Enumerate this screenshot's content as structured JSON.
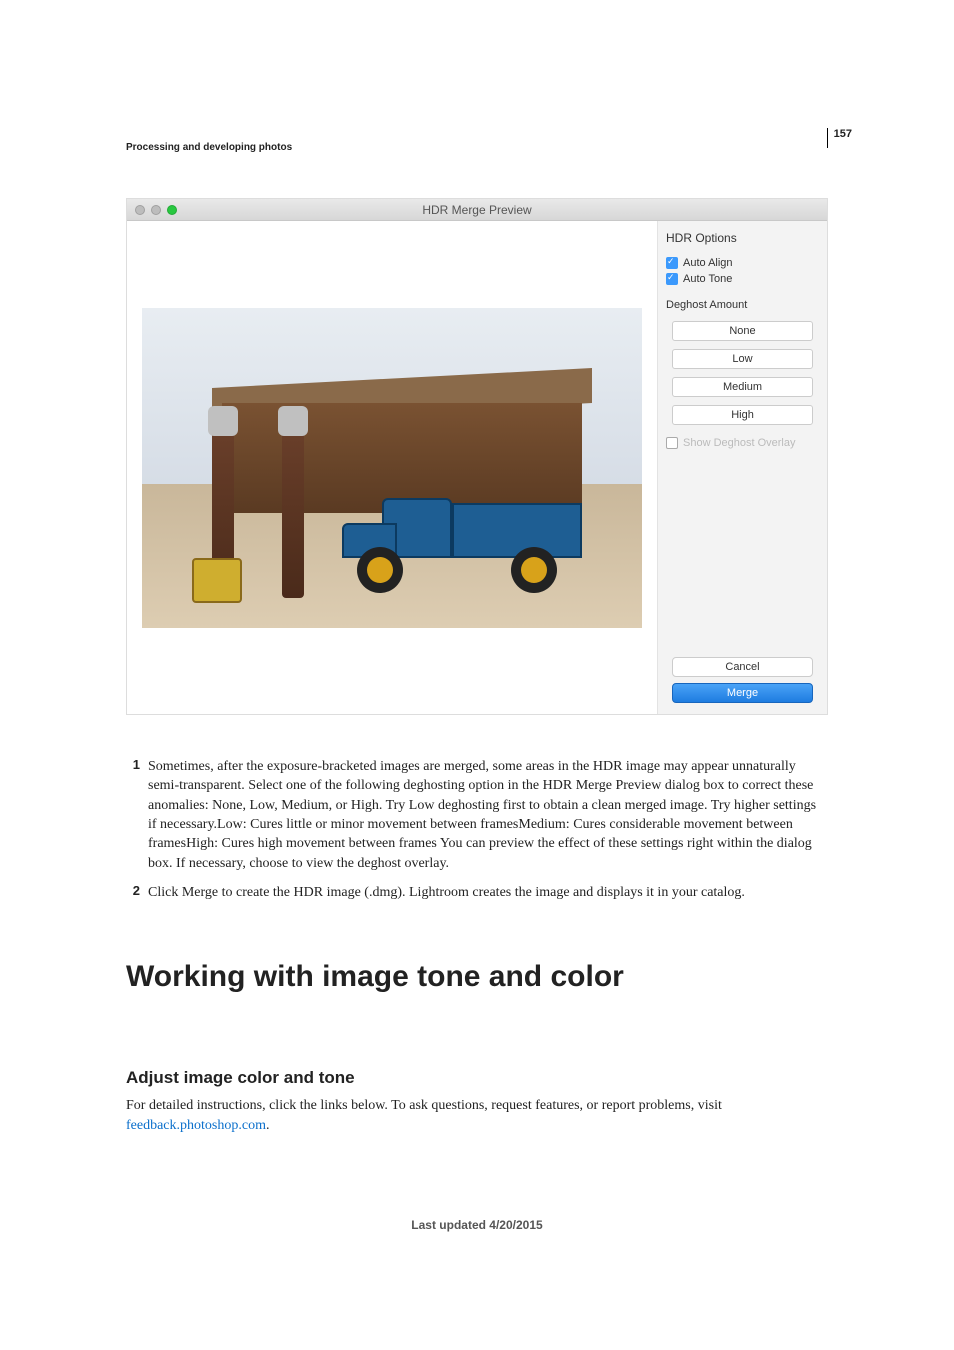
{
  "page_number": "157",
  "running_header": "Processing and developing photos",
  "dialog": {
    "title": "HDR Merge Preview",
    "panel_heading": "HDR Options",
    "auto_align": "Auto Align",
    "auto_tone": "Auto Tone",
    "deghost_label": "Deghost Amount",
    "opts": {
      "none": "None",
      "low": "Low",
      "medium": "Medium",
      "high": "High"
    },
    "show_overlay": "Show Deghost Overlay",
    "cancel": "Cancel",
    "merge": "Merge"
  },
  "steps": {
    "s1num": "1",
    "s1": "Sometimes, after the exposure-bracketed images are merged, some areas in the HDR image may appear unnaturally semi-transparent. Select one of the following deghosting option in the HDR Merge Preview dialog box to correct these anomalies: None, Low, Medium, or High. Try Low deghosting first to obtain a clean merged image. Try higher settings if necessary.Low: Cures little or minor movement between framesMedium: Cures considerable movement between framesHigh: Cures high movement between frames You can preview the effect of these settings right within the dialog box. If necessary, choose to view the deghost overlay.",
    "s2num": "2",
    "s2": "Click Merge to create the HDR image (.dmg). Lightroom creates the image and displays it in your catalog."
  },
  "heading_main": "Working with image tone and color",
  "heading_sub": "Adjust image color and tone",
  "para_intro": "For detailed instructions, click the links below. To ask questions, request features, or report problems, visit ",
  "link_text": "feedback.photoshop.com",
  "para_end": ".",
  "footer": "Last updated 4/20/2015"
}
